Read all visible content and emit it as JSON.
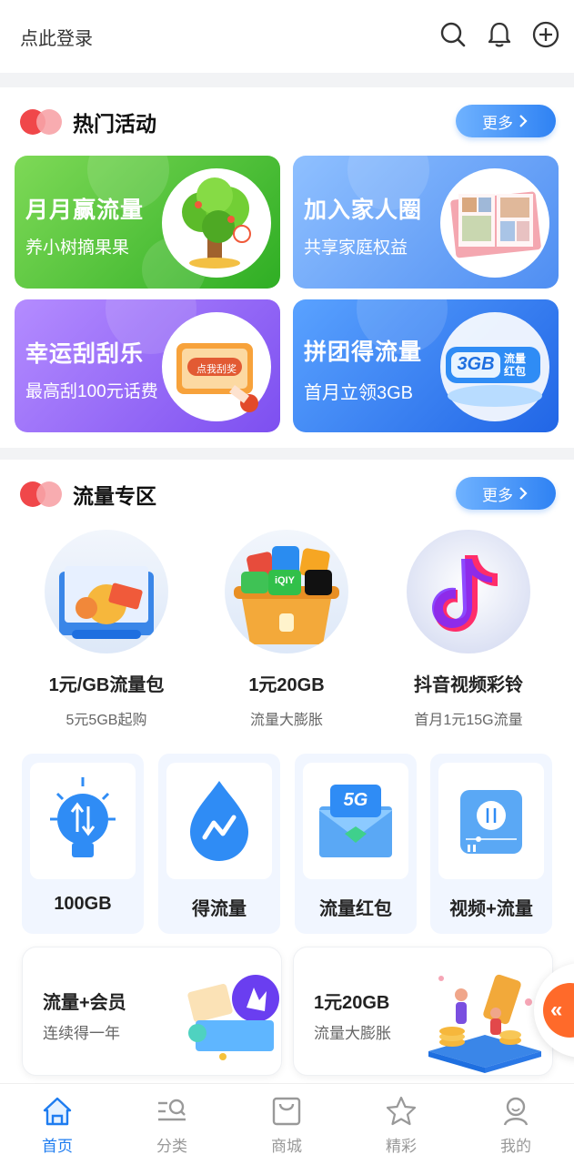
{
  "header": {
    "login_text": "点此登录",
    "icons": [
      "search-icon",
      "bell-icon",
      "add-icon"
    ]
  },
  "hot_activities": {
    "title": "热门活动",
    "more_label": "更多",
    "banners": [
      {
        "title": "月月赢流量",
        "subtitle": "养小树摘果果",
        "color": "#3cbd2c"
      },
      {
        "title": "加入家人圈",
        "subtitle": "共享家庭权益",
        "color": "#5f9ef5"
      },
      {
        "title": "幸运刮刮乐",
        "subtitle": "最高刮100元话费",
        "badge": "点我刮奖",
        "color": "#8a5cf0"
      },
      {
        "title": "拼团得流量",
        "subtitle": "首月立领3GB",
        "badge": "3GB",
        "badge_sub": "流量红包",
        "color": "#2f78ee"
      }
    ]
  },
  "traffic_zone": {
    "title": "流量专区",
    "more_label": "更多",
    "products": [
      {
        "title": "1元/GB流量包",
        "subtitle": "5元5GB起购"
      },
      {
        "title": "1元20GB",
        "subtitle": "流量大膨胀",
        "app_badge": "iQIY"
      },
      {
        "title": "抖音视频彩铃",
        "subtitle": "首月1元15G流量"
      }
    ],
    "shortcuts": [
      {
        "label": "100GB",
        "icon": "lightbulb-icon"
      },
      {
        "label": "得流量",
        "icon": "droplet-icon"
      },
      {
        "label": "流量红包",
        "icon": "envelope-5g-icon",
        "badge": "5G"
      },
      {
        "label": "视频+流量",
        "icon": "video-player-icon"
      }
    ],
    "promos": [
      {
        "title": "流量+会员",
        "subtitle": "连续得一年"
      },
      {
        "title": "1元20GB",
        "subtitle": "流量大膨胀"
      }
    ]
  },
  "float_button": {
    "label": "«"
  },
  "tabbar": {
    "active": "首页",
    "active_color": "#1e7cf0",
    "items": [
      {
        "label": "首页",
        "icon": "home-icon"
      },
      {
        "label": "分类",
        "icon": "category-search-icon"
      },
      {
        "label": "商城",
        "icon": "shopping-bag-icon"
      },
      {
        "label": "精彩",
        "icon": "star-icon"
      },
      {
        "label": "我的",
        "icon": "profile-icon"
      }
    ]
  }
}
